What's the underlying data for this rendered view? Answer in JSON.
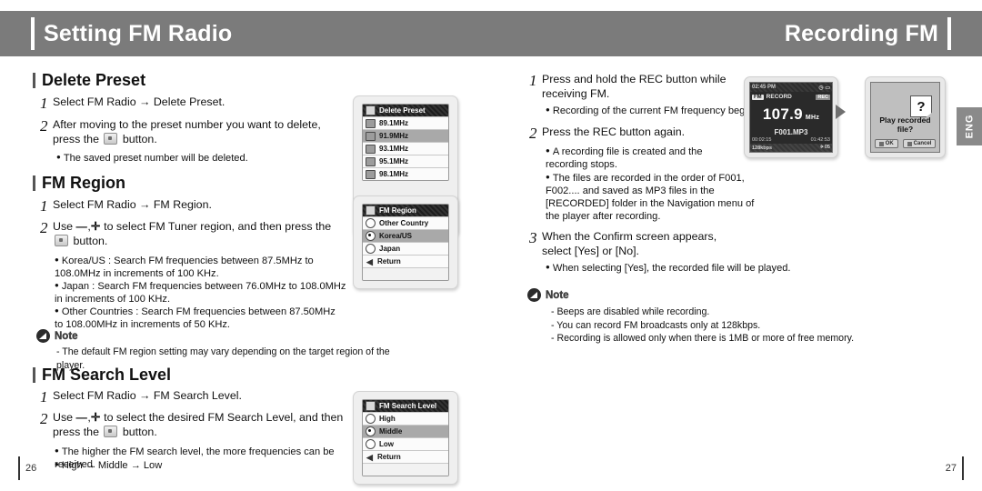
{
  "header": {
    "left_title": "Setting FM Radio",
    "right_title": "Recording FM"
  },
  "left_page": {
    "page_number": "26",
    "sections": [
      {
        "heading": "Delete Preset",
        "steps": [
          {
            "num": "1",
            "text": "Select FM Radio  →  Delete Preset."
          },
          {
            "num": "2",
            "text_a": "After moving to the preset number you want to delete,",
            "text_b_pre": "press the ",
            "text_b_post": " button."
          }
        ],
        "bullets": [
          "The saved preset number will be deleted."
        ]
      },
      {
        "heading": "FM Region",
        "steps": [
          {
            "num": "1",
            "text": "Select FM Radio  →  FM Region."
          },
          {
            "num": "2",
            "text_a_pre": "Use ",
            "minus": "—",
            "comma": ",",
            "plus": "✛",
            "text_a_post": " to select FM Tuner region, and then press the",
            "text_b_post": " button."
          }
        ],
        "bullets": [
          "Korea/US : Search FM frequencies between 87.5MHz to 108.0MHz in increments of 100 KHz.",
          "Japan : Search FM frequencies between 76.0MHz to 108.0MHz in increments of 100 KHz.",
          "Other Countries : Search FM frequencies between 87.50MHz to 108.00MHz in increments of 50 KHz."
        ],
        "note": {
          "label": "Note",
          "lines": [
            "- The default FM region setting may vary depending on the target region of the player."
          ]
        }
      },
      {
        "heading": "FM Search Level",
        "steps": [
          {
            "num": "1",
            "text": "Select FM Radio  →  FM Search Level."
          },
          {
            "num": "2",
            "text_a_pre": "Use ",
            "minus": "—",
            "comma": ",",
            "plus": "✛",
            "text_a_post": " to select the desired FM Search Level, and then",
            "text_b_pre": "press the ",
            "text_b_post": " button."
          }
        ],
        "bullets": [
          "The higher the FM search level, the more frequencies can be received.",
          "High  →  Middle  →  Low"
        ]
      }
    ],
    "menus": [
      {
        "name": "delete-preset-menu",
        "title": "Delete Preset",
        "items": [
          {
            "label": "89.1MHz",
            "selected": false
          },
          {
            "label": "91.9MHz",
            "selected": true
          },
          {
            "label": "93.1MHz",
            "selected": false
          },
          {
            "label": "95.1MHz",
            "selected": false
          },
          {
            "label": "98.1MHz",
            "selected": false
          }
        ]
      },
      {
        "name": "fm-region-menu",
        "title": "FM Region",
        "items": [
          {
            "label": "Other Country",
            "selected": false,
            "radio": true,
            "on": false
          },
          {
            "label": "Korea/US",
            "selected": true,
            "radio": true,
            "on": true
          },
          {
            "label": "Japan",
            "selected": false,
            "radio": true,
            "on": false
          },
          {
            "label": "Return",
            "selected": false,
            "back": true
          }
        ]
      },
      {
        "name": "fm-search-level-menu",
        "title": "FM Search Level",
        "items": [
          {
            "label": "High",
            "selected": false,
            "radio": true,
            "on": false
          },
          {
            "label": "Middle",
            "selected": true,
            "radio": true,
            "on": true
          },
          {
            "label": "Low",
            "selected": false,
            "radio": true,
            "on": false
          },
          {
            "label": "Return",
            "selected": false,
            "back": true
          }
        ]
      }
    ]
  },
  "right_page": {
    "page_number": "27",
    "steps": [
      {
        "num": "1",
        "line1": "Press and hold the REC button while",
        "line2": "receiving FM.",
        "bullets": [
          "Recording of the current FM frequency begins."
        ]
      },
      {
        "num": "2",
        "line1": "Press the REC button again.",
        "bullets": [
          "A recording file is created and the recording stops.",
          "The files are recorded in the order of F001, F002.... and saved as MP3 files in the [RECORDED] folder in the Navigation menu of the player after recording."
        ]
      },
      {
        "num": "3",
        "line1": "When the Confirm screen appears,",
        "line2": "select  [Yes] or [No].",
        "bullets": [
          "When selecting [Yes], the recorded file will be played."
        ]
      }
    ],
    "note": {
      "label": "Note",
      "lines": [
        "- Beeps are disabled while recording.",
        "- You can record FM broadcasts only at 128kbps.",
        "- Recording is allowed only when there is 1MB or more of free memory."
      ]
    },
    "device": {
      "screen1": {
        "status_left": "02:45 PM",
        "status_right": "",
        "mode_tag": "FM",
        "mode_label": "RECORD",
        "rec_tag": "REC",
        "frequency": "107.9",
        "unit": "MHz",
        "file_name": "F001.MP3",
        "bitrate": "128kbps",
        "volume": "VOL",
        "time_left": "00:02:15",
        "time_right": "01:42:53"
      },
      "screen2": {
        "question_icon": "?",
        "prompt": "Play recorded file?",
        "ok_label": "OK",
        "cancel_label": "Cancel"
      }
    },
    "lang_tab": "ENG"
  }
}
